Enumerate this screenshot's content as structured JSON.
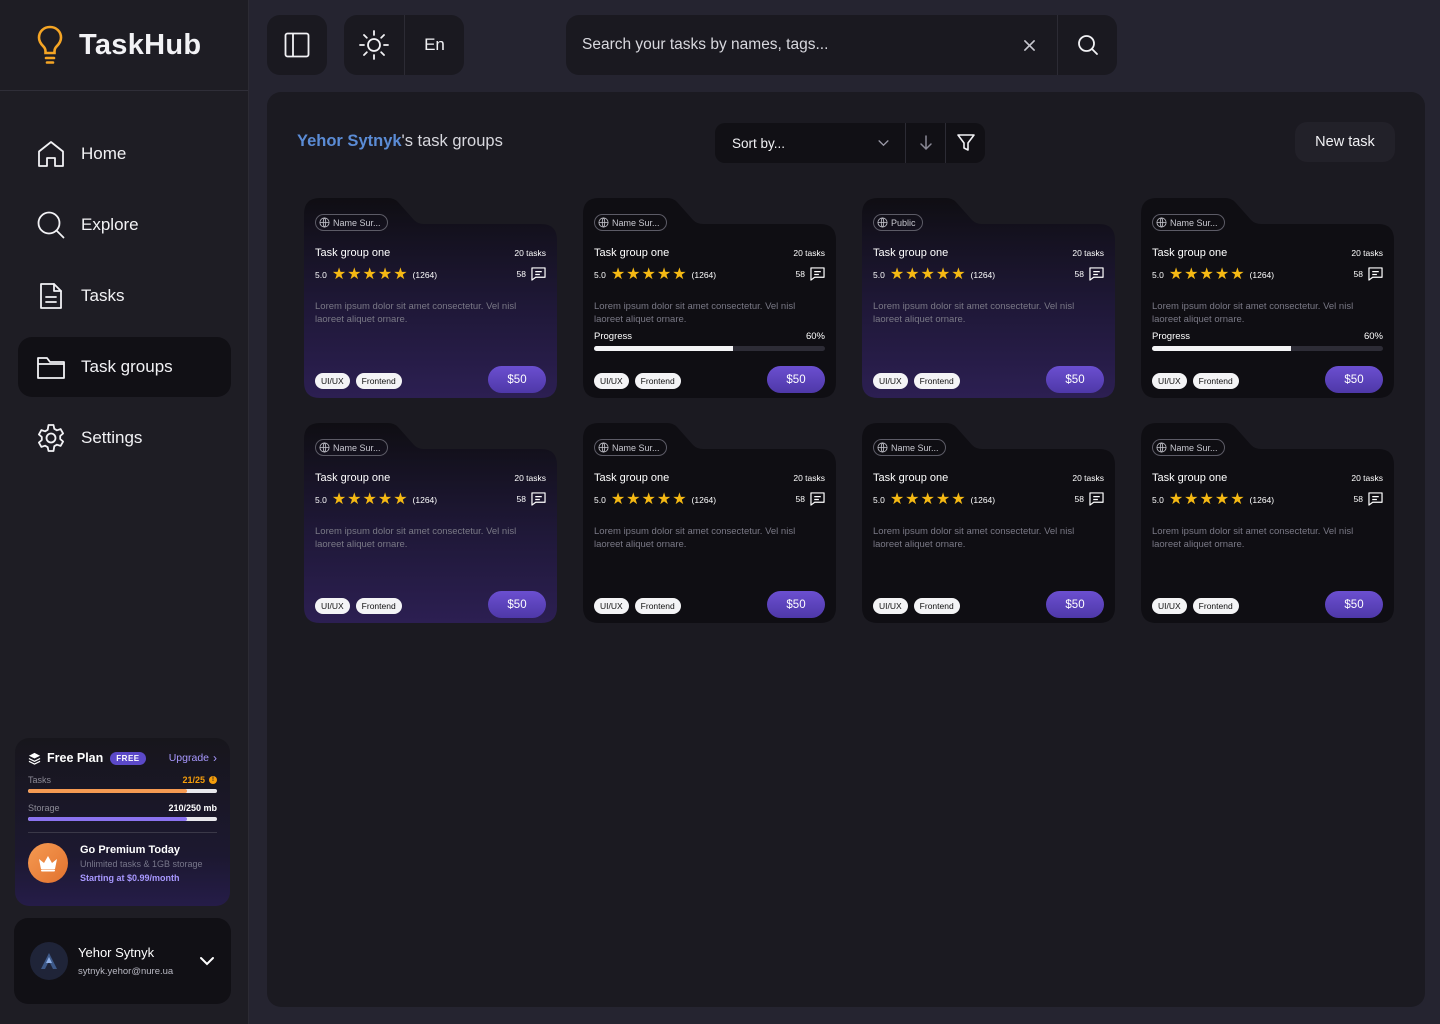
{
  "app": {
    "name": "TaskHub"
  },
  "sidebar": {
    "items": [
      {
        "label": "Home",
        "icon": "home-icon",
        "active": false
      },
      {
        "label": "Explore",
        "icon": "search-icon",
        "active": false
      },
      {
        "label": "Tasks",
        "icon": "document-icon",
        "active": false
      },
      {
        "label": "Task groups",
        "icon": "folder-icon",
        "active": true
      },
      {
        "label": "Settings",
        "icon": "gear-icon",
        "active": false
      }
    ]
  },
  "plan": {
    "title": "Free Plan",
    "badge": "FREE",
    "upgrade": "Upgrade",
    "tasks_label": "Tasks",
    "tasks_value": "21/25",
    "tasks_fraction": 0.84,
    "storage_label": "Storage",
    "storage_value": "210/250 mb",
    "storage_fraction": 0.84,
    "premium_title": "Go Premium Today",
    "premium_sub": "Unlimited tasks & 1GB storage",
    "premium_price": "Starting at $0.99/month",
    "colors": {
      "tasks_fill": "#f59a52",
      "storage_fill": "#8b73f0"
    }
  },
  "user": {
    "name": "Yehor Sytnyk",
    "email": "sytnyk.yehor@nure.ua"
  },
  "topbar": {
    "language": "En",
    "search_placeholder": "Search your tasks by names, tags..."
  },
  "main": {
    "owner": "Yehor Sytnyk",
    "heading_suffix": "'s task groups",
    "sort_placeholder": "Sort by...",
    "new_task": "New task"
  },
  "cards": [
    {
      "owner": "Name Sur...",
      "title": "Task group one",
      "tasks": "20 tasks",
      "rating": "5.0",
      "reviews": "(1264)",
      "comments": "58",
      "desc": "Lorem ipsum dolor sit amet consectetur. Vel nisl laoreet aliquet ornare.",
      "progress_label": "",
      "progress_value": "",
      "progress": null,
      "tags": [
        "UI/UX",
        "Frontend"
      ],
      "price": "$50",
      "gradient": true
    },
    {
      "owner": "Name Sur...",
      "title": "Task group one",
      "tasks": "20 tasks",
      "rating": "5.0",
      "reviews": "(1264)",
      "comments": "58",
      "desc": "Lorem ipsum dolor sit amet consectetur. Vel nisl laoreet aliquet ornare.",
      "progress_label": "Progress",
      "progress_value": "60%",
      "progress": 0.6,
      "tags": [
        "UI/UX",
        "Frontend"
      ],
      "price": "$50",
      "gradient": false
    },
    {
      "owner": "Public",
      "title": "Task group one",
      "tasks": "20 tasks",
      "rating": "5.0",
      "reviews": "(1264)",
      "comments": "58",
      "desc": "Lorem ipsum dolor sit amet consectetur. Vel nisl laoreet aliquet ornare.",
      "progress_label": "",
      "progress_value": "",
      "progress": null,
      "tags": [
        "UI/UX",
        "Frontend"
      ],
      "price": "$50",
      "gradient": true
    },
    {
      "owner": "Name Sur...",
      "title": "Task group one",
      "tasks": "20 tasks",
      "rating": "5.0",
      "reviews": "(1264)",
      "comments": "58",
      "desc": "Lorem ipsum dolor sit amet consectetur. Vel nisl laoreet aliquet ornare.",
      "progress_label": "Progress",
      "progress_value": "60%",
      "progress": 0.6,
      "tags": [
        "UI/UX",
        "Frontend"
      ],
      "price": "$50",
      "gradient": false
    },
    {
      "owner": "Name Sur...",
      "title": "Task group one",
      "tasks": "20 tasks",
      "rating": "5.0",
      "reviews": "(1264)",
      "comments": "58",
      "desc": "Lorem ipsum dolor sit amet consectetur. Vel nisl laoreet aliquet ornare.",
      "progress_label": "",
      "progress_value": "",
      "progress": null,
      "tags": [
        "UI/UX",
        "Frontend"
      ],
      "price": "$50",
      "gradient": true
    },
    {
      "owner": "Name Sur...",
      "title": "Task group one",
      "tasks": "20 tasks",
      "rating": "5.0",
      "reviews": "(1264)",
      "comments": "58",
      "desc": "Lorem ipsum dolor sit amet consectetur. Vel nisl laoreet aliquet ornare.",
      "progress_label": "",
      "progress_value": "",
      "progress": null,
      "tags": [
        "UI/UX",
        "Frontend"
      ],
      "price": "$50",
      "gradient": false
    },
    {
      "owner": "Name Sur...",
      "title": "Task group one",
      "tasks": "20 tasks",
      "rating": "5.0",
      "reviews": "(1264)",
      "comments": "58",
      "desc": "Lorem ipsum dolor sit amet consectetur. Vel nisl laoreet aliquet ornare.",
      "progress_label": "",
      "progress_value": "",
      "progress": null,
      "tags": [
        "UI/UX",
        "Frontend"
      ],
      "price": "$50",
      "gradient": false
    },
    {
      "owner": "Name Sur...",
      "title": "Task group one",
      "tasks": "20 tasks",
      "rating": "5.0",
      "reviews": "(1264)",
      "comments": "58",
      "desc": "Lorem ipsum dolor sit amet consectetur. Vel nisl laoreet aliquet ornare.",
      "progress_label": "",
      "progress_value": "",
      "progress": null,
      "tags": [
        "UI/UX",
        "Frontend"
      ],
      "price": "$50",
      "gradient": false
    }
  ],
  "colors": {
    "accent": "#5b49c8",
    "owner_link": "#5b8cd6",
    "star": "#f5b914",
    "brand_bulb": "#f5a524"
  }
}
